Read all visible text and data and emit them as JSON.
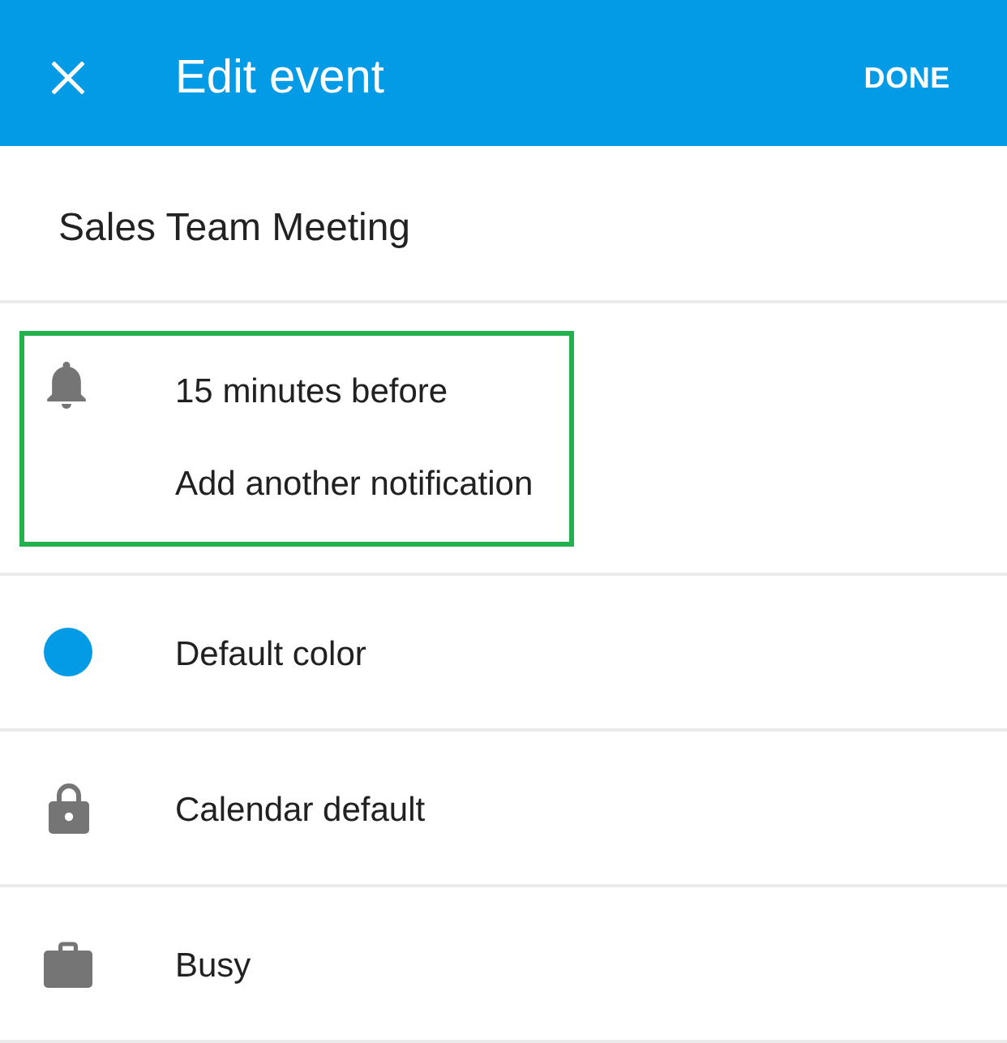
{
  "app_bar": {
    "title": "Edit event",
    "action": "DONE"
  },
  "event": {
    "title": "Sales Team Meeting"
  },
  "sections": [
    {
      "kind": "notifications",
      "highlighted": true,
      "items": [
        "15 minutes before",
        "Add another notification"
      ]
    },
    {
      "kind": "color",
      "label": "Default color",
      "color": "#039be5"
    },
    {
      "kind": "visibility",
      "label": "Calendar default"
    },
    {
      "kind": "availability",
      "label": "Busy"
    }
  ]
}
